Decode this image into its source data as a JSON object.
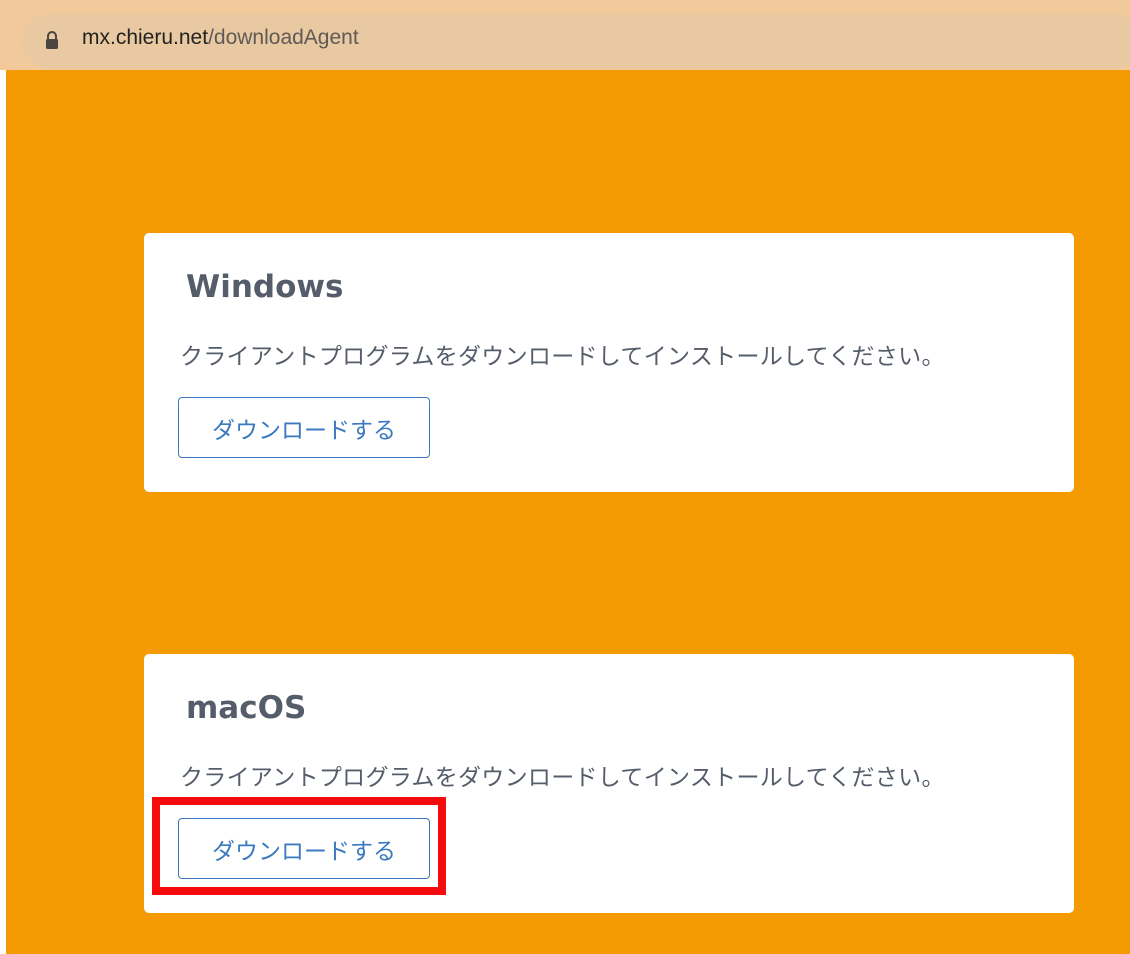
{
  "browser": {
    "url_host": "mx.chieru.net",
    "url_path": "/downloadAgent"
  },
  "colors": {
    "background": "#f49a03",
    "card": "#ffffff",
    "text": "#555d6b",
    "button_accent": "#3b79c0",
    "highlight": "#f50b0b"
  },
  "sections": [
    {
      "title": "Windows",
      "description": "クライアントプログラムをダウンロードしてインストールしてください。",
      "button_label": "ダウンロードする"
    },
    {
      "title": "macOS",
      "description": "クライアントプログラムをダウンロードしてインストールしてください。",
      "button_label": "ダウンロードする"
    }
  ]
}
